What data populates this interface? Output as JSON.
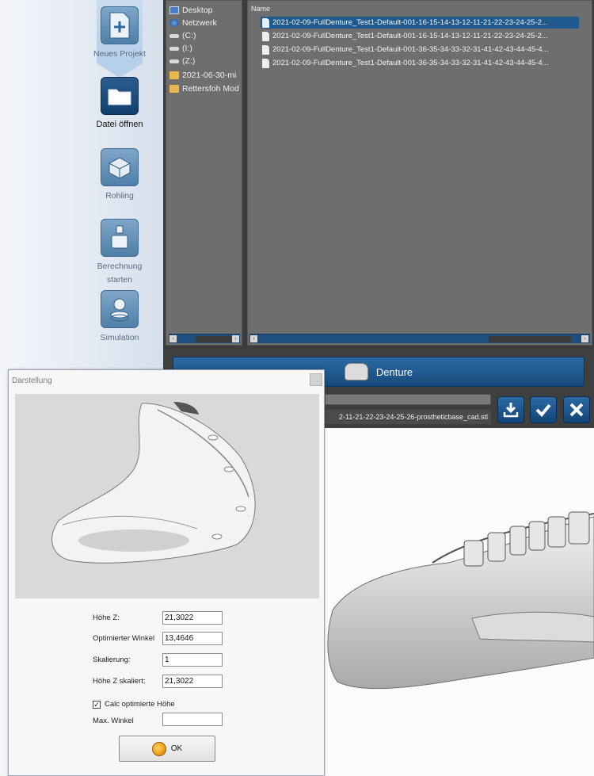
{
  "sidebar": {
    "tools": [
      {
        "label": "Neues Projekt",
        "icon": "new-project-plus-icon"
      },
      {
        "label": "Datei öffnen",
        "icon": "folder-open-icon"
      },
      {
        "label": "Rohling",
        "icon": "blank-block-icon"
      },
      {
        "label": "Berechnung",
        "label2": "starten",
        "icon": "calculate-icon"
      },
      {
        "label": "Simulation",
        "icon": "simulation-icon"
      }
    ]
  },
  "browser": {
    "tree": [
      {
        "label": "Desktop",
        "icon": "desktop-icon"
      },
      {
        "label": "Netzwerk",
        "icon": "network-icon"
      },
      {
        "label": "(C:)",
        "icon": "drive-icon"
      },
      {
        "label": "(I:)",
        "icon": "drive-icon"
      },
      {
        "label": "(Z:)",
        "icon": "drive-icon"
      },
      {
        "label": "2021-06-30-mi",
        "icon": "folder-icon"
      },
      {
        "label": "Rettersfoh Mod",
        "icon": "folder-icon"
      }
    ],
    "column_header": "Name",
    "files": [
      "2021-02-09-FullDenture_Test1-Default-001-16-15-14-13-12-11-21-22-23-24-25-2...",
      "2021-02-09-FullDenture_Test1-Default-001-16-15-14-13-12-11-21-22-23-24-25-2...",
      "2021-02-09-FullDenture_Test1-Default-001-36-35-34-33-32-31-41-42-43-44-45-4...",
      "2021-02-09-FullDenture_Test1-Default-001-36-35-34-33-32-31-41-42-43-44-45-4..."
    ],
    "selected_index": 0
  },
  "denture_button": {
    "label": "Denture",
    "icon": "denture-icon"
  },
  "filename": "2-11-21-22-23-24-25-26-prostheticbase_cad.stl",
  "actions": {
    "download_icon": "download-icon",
    "confirm_icon": "checkmark-icon",
    "cancel_icon": "close-icon"
  },
  "dialog": {
    "title": "Darstellung",
    "fields": [
      {
        "label": "Höhe Z:",
        "value": "21,3022"
      },
      {
        "label": "Optimierter Winkel",
        "value": "13,4646"
      },
      {
        "label": "Skalierung:",
        "value": "1"
      },
      {
        "label": "Höhe Z skaliert:",
        "value": "21,3022"
      }
    ],
    "checkbox": {
      "label": "Calc optimierte Höhe",
      "checked": true,
      "mark": "✓"
    },
    "max_angle": {
      "label": "Max. Winkel",
      "value": ""
    },
    "ok_label": "OK"
  },
  "colors": {
    "accent_blue": "#1f5a8f",
    "panel_gray": "#6e6e6e",
    "dark_bg": "#3c3c3c"
  }
}
